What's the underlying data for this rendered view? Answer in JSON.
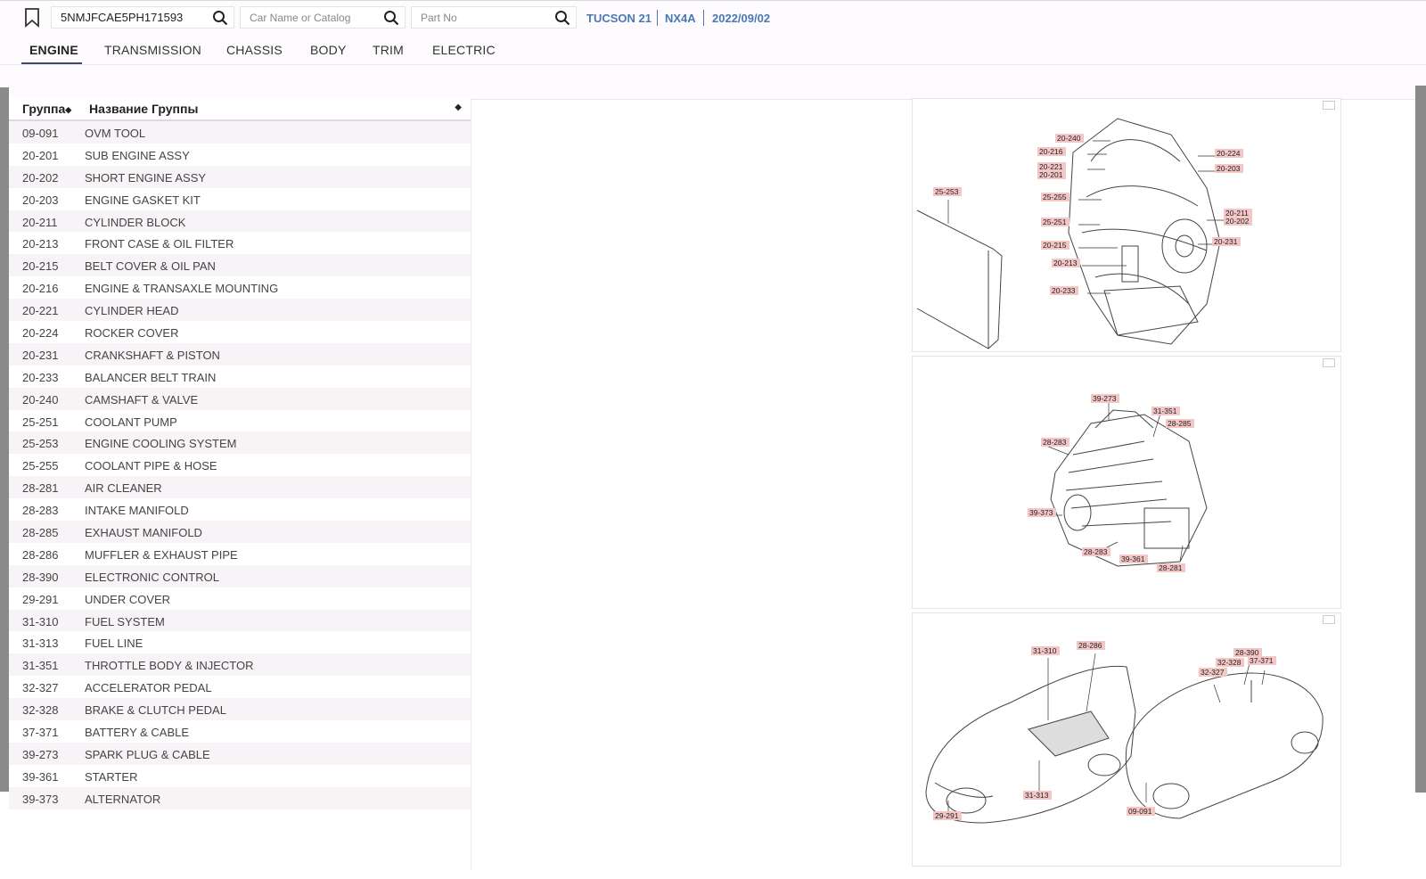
{
  "search": {
    "vin_value": "5NMJFCAE5PH171593",
    "car_placeholder": "Car Name or Catalog",
    "part_placeholder": "Part No"
  },
  "vehicle": {
    "model": "TUCSON 21",
    "code": "NX4A",
    "date": "2022/09/02"
  },
  "tabs": [
    "ENGINE",
    "TRANSMISSION",
    "CHASSIS",
    "BODY",
    "TRIM",
    "ELECTRIC"
  ],
  "table": {
    "col_group": "Группа",
    "col_name": "Название Группы",
    "rows": [
      {
        "code": "09-091",
        "name": "OVM TOOL"
      },
      {
        "code": "20-201",
        "name": "SUB ENGINE ASSY"
      },
      {
        "code": "20-202",
        "name": "SHORT ENGINE ASSY"
      },
      {
        "code": "20-203",
        "name": "ENGINE GASKET KIT"
      },
      {
        "code": "20-211",
        "name": "CYLINDER BLOCK"
      },
      {
        "code": "20-213",
        "name": "FRONT CASE & OIL FILTER"
      },
      {
        "code": "20-215",
        "name": "BELT COVER & OIL PAN"
      },
      {
        "code": "20-216",
        "name": "ENGINE & TRANSAXLE MOUNTING"
      },
      {
        "code": "20-221",
        "name": "CYLINDER HEAD"
      },
      {
        "code": "20-224",
        "name": "ROCKER COVER"
      },
      {
        "code": "20-231",
        "name": "CRANKSHAFT & PISTON"
      },
      {
        "code": "20-233",
        "name": "BALANCER BELT TRAIN"
      },
      {
        "code": "20-240",
        "name": "CAMSHAFT & VALVE"
      },
      {
        "code": "25-251",
        "name": "COOLANT PUMP"
      },
      {
        "code": "25-253",
        "name": "ENGINE COOLING SYSTEM"
      },
      {
        "code": "25-255",
        "name": "COOLANT PIPE & HOSE"
      },
      {
        "code": "28-281",
        "name": "AIR CLEANER"
      },
      {
        "code": "28-283",
        "name": "INTAKE MANIFOLD"
      },
      {
        "code": "28-285",
        "name": "EXHAUST MANIFOLD"
      },
      {
        "code": "28-286",
        "name": "MUFFLER & EXHAUST PIPE"
      },
      {
        "code": "28-390",
        "name": "ELECTRONIC CONTROL"
      },
      {
        "code": "29-291",
        "name": "UNDER COVER"
      },
      {
        "code": "31-310",
        "name": "FUEL SYSTEM"
      },
      {
        "code": "31-313",
        "name": "FUEL LINE"
      },
      {
        "code": "31-351",
        "name": "THROTTLE BODY & INJECTOR"
      },
      {
        "code": "32-327",
        "name": "ACCELERATOR PEDAL"
      },
      {
        "code": "32-328",
        "name": "BRAKE & CLUTCH PEDAL"
      },
      {
        "code": "37-371",
        "name": "BATTERY & CABLE"
      },
      {
        "code": "39-273",
        "name": "SPARK PLUG & CABLE"
      },
      {
        "code": "39-361",
        "name": "STARTER"
      },
      {
        "code": "39-373",
        "name": "ALTERNATOR"
      }
    ]
  },
  "diagrams": [
    {
      "labels": [
        "20-240",
        "20-216",
        "20-221",
        "20-201",
        "25-255",
        "25-251",
        "20-215",
        "20-213",
        "20-233",
        "20-224",
        "20-203",
        "20-211",
        "20-202",
        "20-231",
        "25-253"
      ]
    },
    {
      "labels": [
        "39-273",
        "31-351",
        "28-285",
        "28-283",
        "39-373",
        "28-283",
        "39-361",
        "28-281"
      ]
    },
    {
      "labels": [
        "31-310",
        "28-286",
        "29-291",
        "31-313",
        "28-390",
        "32-328",
        "37-371",
        "32-327",
        "09-091"
      ]
    }
  ]
}
